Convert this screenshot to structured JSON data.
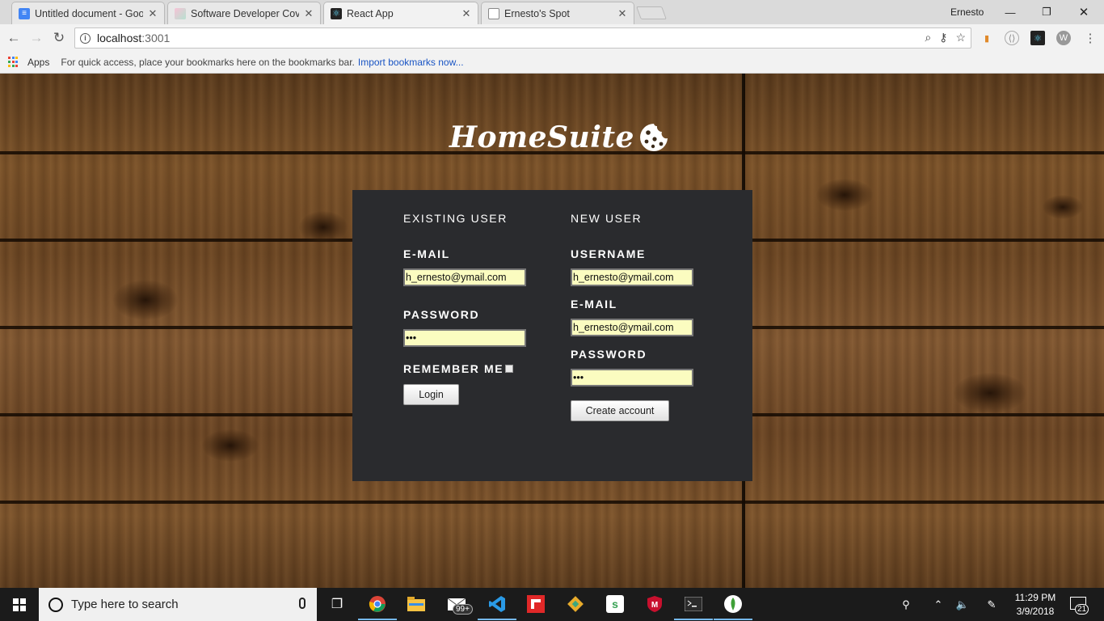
{
  "browser": {
    "tabs": [
      {
        "title": "Untitled document - Goo",
        "active": false,
        "favicon": "google-docs-icon",
        "color": "#4285f4"
      },
      {
        "title": "Software Developer Cove",
        "active": false,
        "favicon": "gradient-page-icon",
        "color": "#f2a3c0"
      },
      {
        "title": "React App",
        "active": true,
        "favicon": "react-icon",
        "color": "#222222"
      },
      {
        "title": "Ernesto's Spot",
        "active": false,
        "favicon": "blank-page-icon",
        "color": "#ffffff"
      }
    ],
    "profile_name": "Ernesto",
    "address": {
      "host": "localhost",
      "port": ":3001"
    },
    "bookmarks": {
      "apps_label": "Apps",
      "hint": "For quick access, place your bookmarks here on the bookmarks bar.",
      "import_link": "Import bookmarks now..."
    }
  },
  "page": {
    "logo_text": "HomeSuite",
    "existing_user": {
      "title": "EXISTING USER",
      "email_label": "E-MAIL",
      "email_value": "h_ernesto@ymail.com",
      "password_label": "PASSWORD",
      "password_value": "•••",
      "remember_label": "REMEMBER ME",
      "remember_checked": false,
      "login_button": "Login"
    },
    "new_user": {
      "title": "NEW USER",
      "username_label": "USERNAME",
      "username_value": "h_ernesto@ymail.com",
      "email_label": "E-MAIL",
      "email_value": "h_ernesto@ymail.com",
      "password_label": "PASSWORD",
      "password_value": "•••",
      "create_button": "Create account"
    },
    "colors": {
      "panel": "#2a2b2e",
      "input_bg": "#fbfcc0",
      "label": "#ffffff"
    }
  },
  "taskbar": {
    "search_placeholder": "Type here to search",
    "mail_badge": "99+",
    "time": "11:29 PM",
    "date": "3/9/2018",
    "notification_count": "21"
  }
}
